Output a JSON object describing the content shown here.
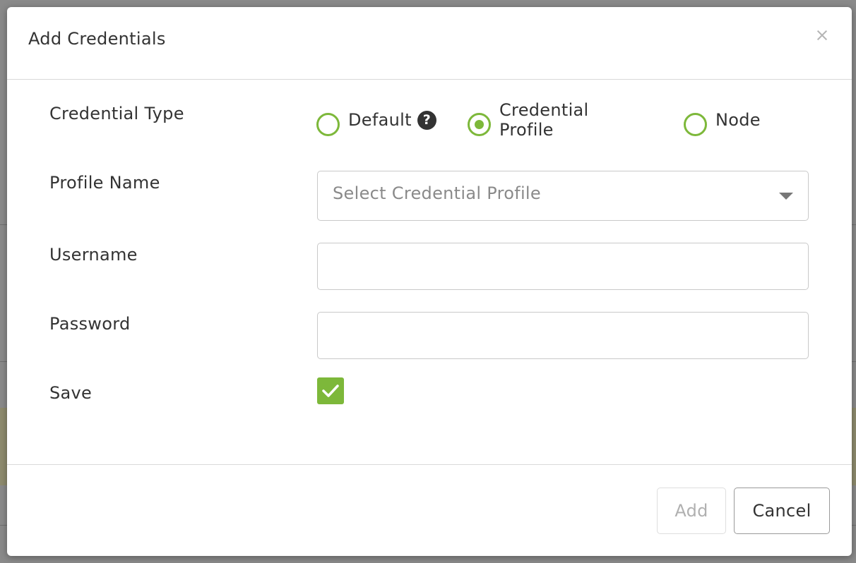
{
  "dialog": {
    "title": "Add Credentials",
    "close_label": "×"
  },
  "form": {
    "credential_type": {
      "label": "Credential Type",
      "options": [
        {
          "label": "Default",
          "checked": false,
          "help_icon": "question-circle-icon"
        },
        {
          "label": "Credential Profile",
          "checked": true
        },
        {
          "label": "Node",
          "checked": false
        }
      ]
    },
    "profile_name": {
      "label": "Profile Name",
      "placeholder": "Select Credential Profile"
    },
    "username": {
      "label": "Username",
      "value": ""
    },
    "password": {
      "label": "Password",
      "value": ""
    },
    "save": {
      "label": "Save",
      "checked": true
    }
  },
  "footer": {
    "add_label": "Add",
    "cancel_label": "Cancel"
  },
  "colors": {
    "accent": "#7db83a",
    "overlay": "#8a8a8a"
  }
}
